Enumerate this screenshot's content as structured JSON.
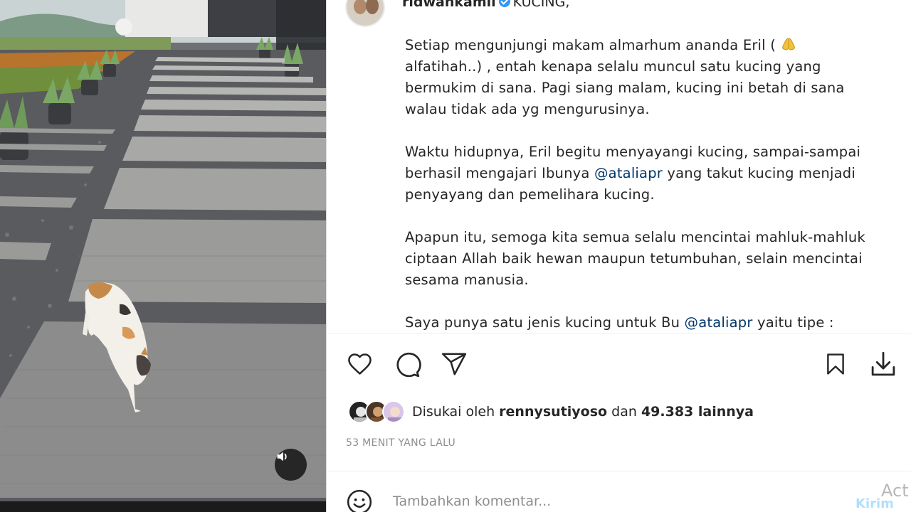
{
  "post": {
    "username": "ridwankamil",
    "caption_title": "KUCING,",
    "caption": {
      "p1_a": "Setiap mengunjungi makam almarhum ananda Eril (",
      "p1_b": "alfatihah..) , entah kenapa selalu muncul satu kucing yang bermukim di sana. Pagi siang malam, kucing ini betah di sana walau tidak ada yg mengurusinya.",
      "p2_a": "Waktu hidupnya, Eril begitu menyayangi kucing, sampai-sampai berhasil mengajari Ibunya ",
      "p2_mention": "@ataliapr",
      "p2_b": " yang takut kucing menjadi penyayang dan pemelihara kucing.",
      "p3": "Apapun itu, semoga kita semua selalu mencintai mahluk-mahluk ciptaan Allah baik hewan maupun tetumbuhan, selain mencintai sesama manusia.",
      "p4_a": "Saya punya satu jenis kucing untuk Bu ",
      "p4_mention": "@ataliapr",
      "p4_b": " yaitu tipe :"
    },
    "emoji": "praying-hands-icon"
  },
  "likes": {
    "prefix": "Disukai oleh",
    "user": "rennysutiyoso",
    "connector": "dan",
    "count": "49.383 lainnya"
  },
  "timestamp": "53 MENIT YANG LALU",
  "comment": {
    "placeholder": "Tambahkan komentar...",
    "post_label": "Kirim"
  },
  "watermark": "Act",
  "icons": {
    "like": "heart-icon",
    "comment": "comment-icon",
    "share": "share-icon",
    "save": "bookmark-icon",
    "download": "download-icon",
    "mute": "speaker-icon",
    "emoji": "smiley-icon"
  },
  "colors": {
    "mention": "#00376b",
    "muted_text": "#8e8e8e",
    "post_button": "#b2dffc",
    "verified": "#3897f0"
  }
}
